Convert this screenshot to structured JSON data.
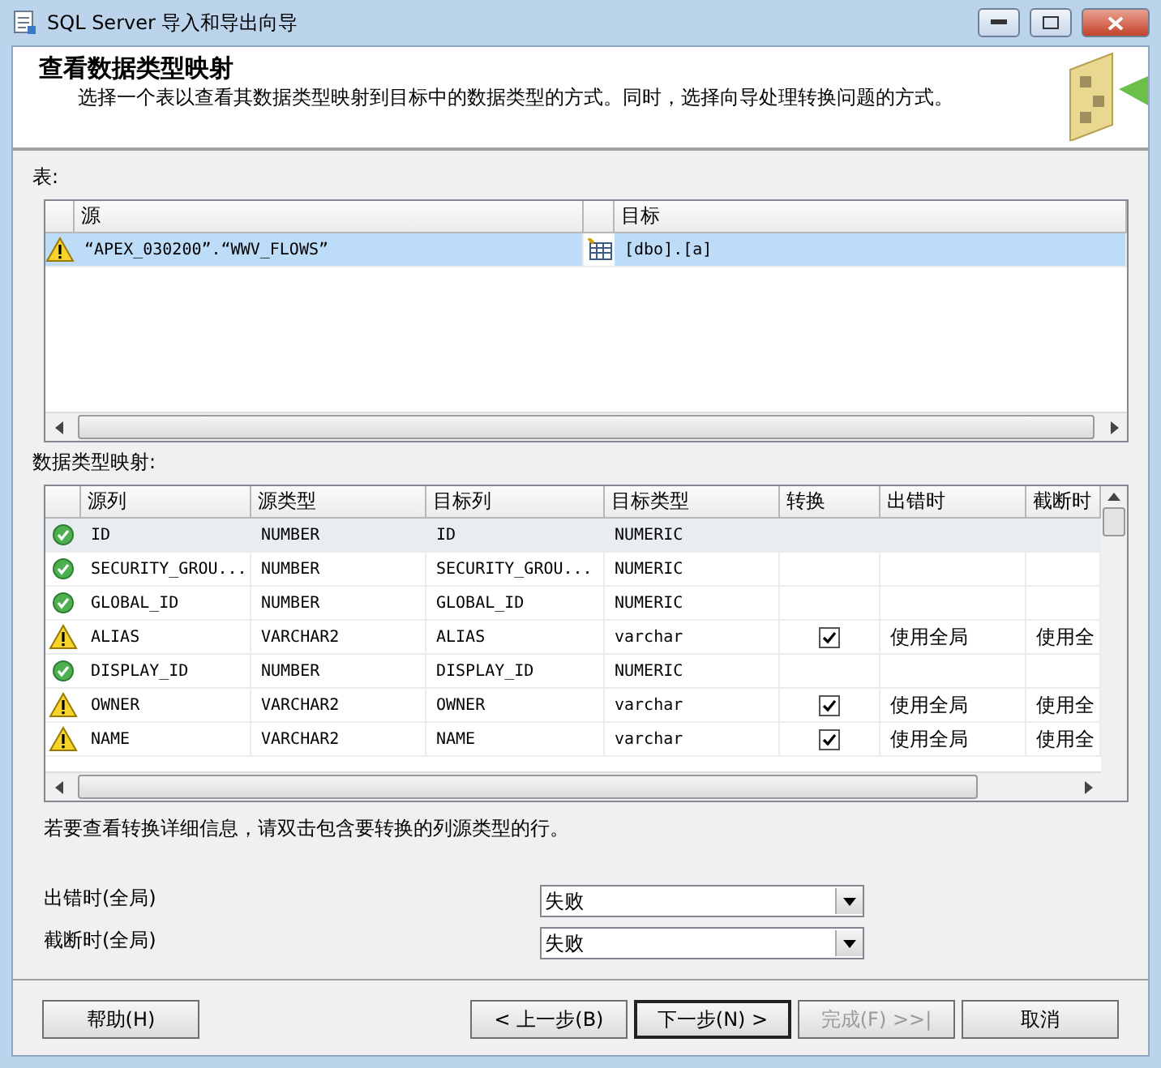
{
  "window": {
    "title": "SQL Server 导入和导出向导"
  },
  "header": {
    "title": "查看数据类型映射",
    "description": "选择一个表以查看其数据类型映射到目标中的数据类型的方式。同时，选择向导处理转换问题的方式。"
  },
  "tables_label": "表:",
  "tables": {
    "columns": [
      "源",
      "目标"
    ],
    "rows": [
      {
        "kind": "warning",
        "source": "“APEX_030200”.“WWV_FLOWS”",
        "target": "[dbo].[a]",
        "selected": true
      }
    ]
  },
  "mapping_label": "数据类型映射:",
  "mapping": {
    "columns": [
      "源列",
      "源类型",
      "目标列",
      "目标类型",
      "转换",
      "出错时",
      "截断时"
    ],
    "rows": [
      {
        "kind": "ok",
        "source_column": "ID",
        "source_type": "NUMBER",
        "target_column": "ID",
        "target_type": "NUMERIC",
        "convert": false,
        "selected": true
      },
      {
        "kind": "ok",
        "source_column": "SECURITY_GROU...",
        "source_type": "NUMBER",
        "target_column": "SECURITY_GROU...",
        "target_type": "NUMERIC",
        "convert": false,
        "selected": false
      },
      {
        "kind": "ok",
        "source_column": "GLOBAL_ID",
        "source_type": "NUMBER",
        "target_column": "GLOBAL_ID",
        "target_type": "NUMERIC",
        "convert": false,
        "selected": false
      },
      {
        "kind": "warning",
        "source_column": "ALIAS",
        "source_type": "VARCHAR2",
        "target_column": "ALIAS",
        "target_type": "varchar",
        "convert": true,
        "on_error": "使用全局",
        "on_truncation": "使用全",
        "selected": false
      },
      {
        "kind": "ok",
        "source_column": "DISPLAY_ID",
        "source_type": "NUMBER",
        "target_column": "DISPLAY_ID",
        "target_type": "NUMERIC",
        "convert": false,
        "selected": false
      },
      {
        "kind": "warning",
        "source_column": "OWNER",
        "source_type": "VARCHAR2",
        "target_column": "OWNER",
        "target_type": "varchar",
        "convert": true,
        "on_error": "使用全局",
        "on_truncation": "使用全",
        "selected": false
      },
      {
        "kind": "warning",
        "source_column": "NAME",
        "source_type": "VARCHAR2",
        "target_column": "NAME",
        "target_type": "varchar",
        "convert": true,
        "on_error": "使用全局",
        "on_truncation": "使用全",
        "selected": false
      }
    ]
  },
  "hint": "若要查看转换详细信息，请双击包含要转换的列源类型的行。",
  "global_settings": [
    {
      "label": "出错时(全局)",
      "value": "失败"
    },
    {
      "label": "截断时(全局)",
      "value": "失败"
    }
  ],
  "buttons": [
    {
      "label": "帮助(H)",
      "kind": "help",
      "disabled": false,
      "default": false
    },
    {
      "label": "< 上一步(B)",
      "kind": "nav",
      "disabled": false,
      "default": false
    },
    {
      "label": "下一步(N) >",
      "kind": "nav",
      "disabled": false,
      "default": true
    },
    {
      "label": "完成(F) >>|",
      "kind": "nav",
      "disabled": true,
      "default": false
    },
    {
      "label": "取消",
      "kind": "cancel",
      "disabled": false,
      "default": false
    }
  ]
}
